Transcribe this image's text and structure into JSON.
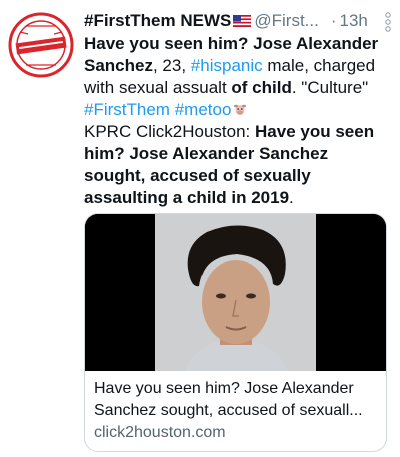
{
  "tweet": {
    "display_name": "#FirstThem NEWS",
    "handle": "@First...",
    "separator": "·",
    "time": "13h",
    "avatar_icon": "accountability-seal-icon",
    "flag_icon": "us-flag-icon",
    "more_icon": "vertical-more-icon",
    "emoji_icon": "cow-face-icon",
    "body": {
      "p1": "Have you seen him? Jose Alexander Sanchez",
      "p2": ", 23, ",
      "hashtag_hispanic": "#hispanic",
      "p3": " male, charged with sexual assualt ",
      "p4": "of child",
      "p5": ". \"Culture\"",
      "hashtag_firstthem": "#FirstThem",
      "hashtag_metoo": "#metoo",
      "p6": "KPRC Click2Houston: ",
      "p7": "Have you seen him? Jose Alexander Sanchez sought, accused of sexually assaulting a child in 2019",
      "p8": "."
    },
    "card": {
      "title": "Have you seen him? Jose Alexander Sanchez sought, accused of sexuall...",
      "domain": "click2houston.com",
      "image_icon": "mugshot-photo-icon"
    }
  },
  "colors": {
    "link": "#1d9bf0",
    "text": "#0f1419",
    "muted": "#657786",
    "seal_red": "#d9252b",
    "card_border": "#cfd9de"
  }
}
